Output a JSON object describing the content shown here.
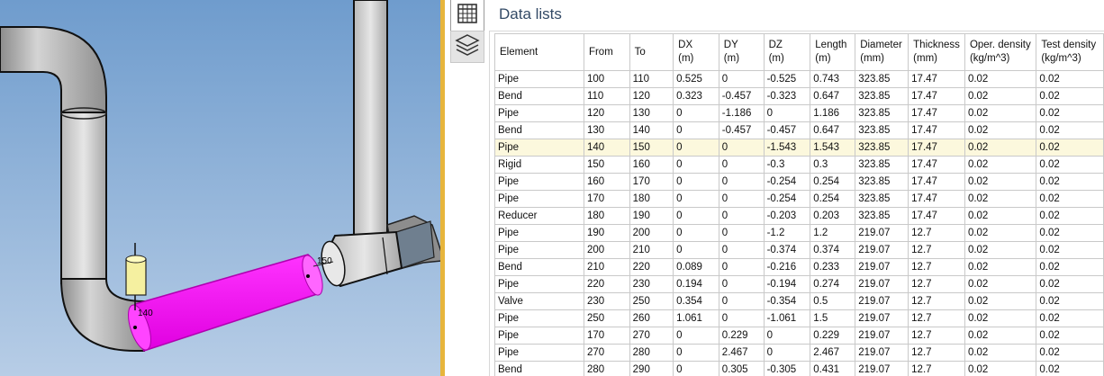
{
  "viewport": {
    "node_labels": {
      "n140": "140",
      "n150": "150"
    },
    "colors": {
      "sky_top": "#6f9ccd",
      "sky_bottom": "#b7cde6",
      "pipe": "#a8a8a8",
      "selected_pipe": "#ff00ff",
      "splitter": "#e7b53c"
    }
  },
  "panel": {
    "data_button_icon": "table-grid-icon",
    "layers_button_icon": "layers-icon",
    "title": "Data lists"
  },
  "table": {
    "columns": [
      {
        "line1": "Element",
        "line2": ""
      },
      {
        "line1": "From",
        "line2": ""
      },
      {
        "line1": "To",
        "line2": ""
      },
      {
        "line1": "DX",
        "line2": "(m)"
      },
      {
        "line1": "DY",
        "line2": "(m)"
      },
      {
        "line1": "DZ",
        "line2": "(m)"
      },
      {
        "line1": "Length",
        "line2": "(m)"
      },
      {
        "line1": "Diameter",
        "line2": "(mm)"
      },
      {
        "line1": "Thickness",
        "line2": "(mm)"
      },
      {
        "line1": "Oper. density",
        "line2": "(kg/m^3)"
      },
      {
        "line1": "Test density",
        "line2": "(kg/m^3)"
      }
    ],
    "selected_row": 4,
    "rows": [
      [
        "Pipe",
        "100",
        "110",
        "0.525",
        "0",
        "-0.525",
        "0.743",
        "323.85",
        "17.47",
        "0.02",
        "0.02"
      ],
      [
        "Bend",
        "110",
        "120",
        "0.323",
        "-0.457",
        "-0.323",
        "0.647",
        "323.85",
        "17.47",
        "0.02",
        "0.02"
      ],
      [
        "Pipe",
        "120",
        "130",
        "0",
        "-1.186",
        "0",
        "1.186",
        "323.85",
        "17.47",
        "0.02",
        "0.02"
      ],
      [
        "Bend",
        "130",
        "140",
        "0",
        "-0.457",
        "-0.457",
        "0.647",
        "323.85",
        "17.47",
        "0.02",
        "0.02"
      ],
      [
        "Pipe",
        "140",
        "150",
        "0",
        "0",
        "-1.543",
        "1.543",
        "323.85",
        "17.47",
        "0.02",
        "0.02"
      ],
      [
        "Rigid",
        "150",
        "160",
        "0",
        "0",
        "-0.3",
        "0.3",
        "323.85",
        "17.47",
        "0.02",
        "0.02"
      ],
      [
        "Pipe",
        "160",
        "170",
        "0",
        "0",
        "-0.254",
        "0.254",
        "323.85",
        "17.47",
        "0.02",
        "0.02"
      ],
      [
        "Pipe",
        "170",
        "180",
        "0",
        "0",
        "-0.254",
        "0.254",
        "323.85",
        "17.47",
        "0.02",
        "0.02"
      ],
      [
        "Reducer",
        "180",
        "190",
        "0",
        "0",
        "-0.203",
        "0.203",
        "323.85",
        "17.47",
        "0.02",
        "0.02"
      ],
      [
        "Pipe",
        "190",
        "200",
        "0",
        "0",
        "-1.2",
        "1.2",
        "219.07",
        "12.7",
        "0.02",
        "0.02"
      ],
      [
        "Pipe",
        "200",
        "210",
        "0",
        "0",
        "-0.374",
        "0.374",
        "219.07",
        "12.7",
        "0.02",
        "0.02"
      ],
      [
        "Bend",
        "210",
        "220",
        "0.089",
        "0",
        "-0.216",
        "0.233",
        "219.07",
        "12.7",
        "0.02",
        "0.02"
      ],
      [
        "Pipe",
        "220",
        "230",
        "0.194",
        "0",
        "-0.194",
        "0.274",
        "219.07",
        "12.7",
        "0.02",
        "0.02"
      ],
      [
        "Valve",
        "230",
        "250",
        "0.354",
        "0",
        "-0.354",
        "0.5",
        "219.07",
        "12.7",
        "0.02",
        "0.02"
      ],
      [
        "Pipe",
        "250",
        "260",
        "1.061",
        "0",
        "-1.061",
        "1.5",
        "219.07",
        "12.7",
        "0.02",
        "0.02"
      ],
      [
        "Pipe",
        "170",
        "270",
        "0",
        "0.229",
        "0",
        "0.229",
        "219.07",
        "12.7",
        "0.02",
        "0.02"
      ],
      [
        "Pipe",
        "270",
        "280",
        "0",
        "2.467",
        "0",
        "2.467",
        "219.07",
        "12.7",
        "0.02",
        "0.02"
      ],
      [
        "Bend",
        "280",
        "290",
        "0",
        "0.305",
        "-0.305",
        "0.431",
        "219.07",
        "12.7",
        "0.02",
        "0.02"
      ]
    ]
  }
}
